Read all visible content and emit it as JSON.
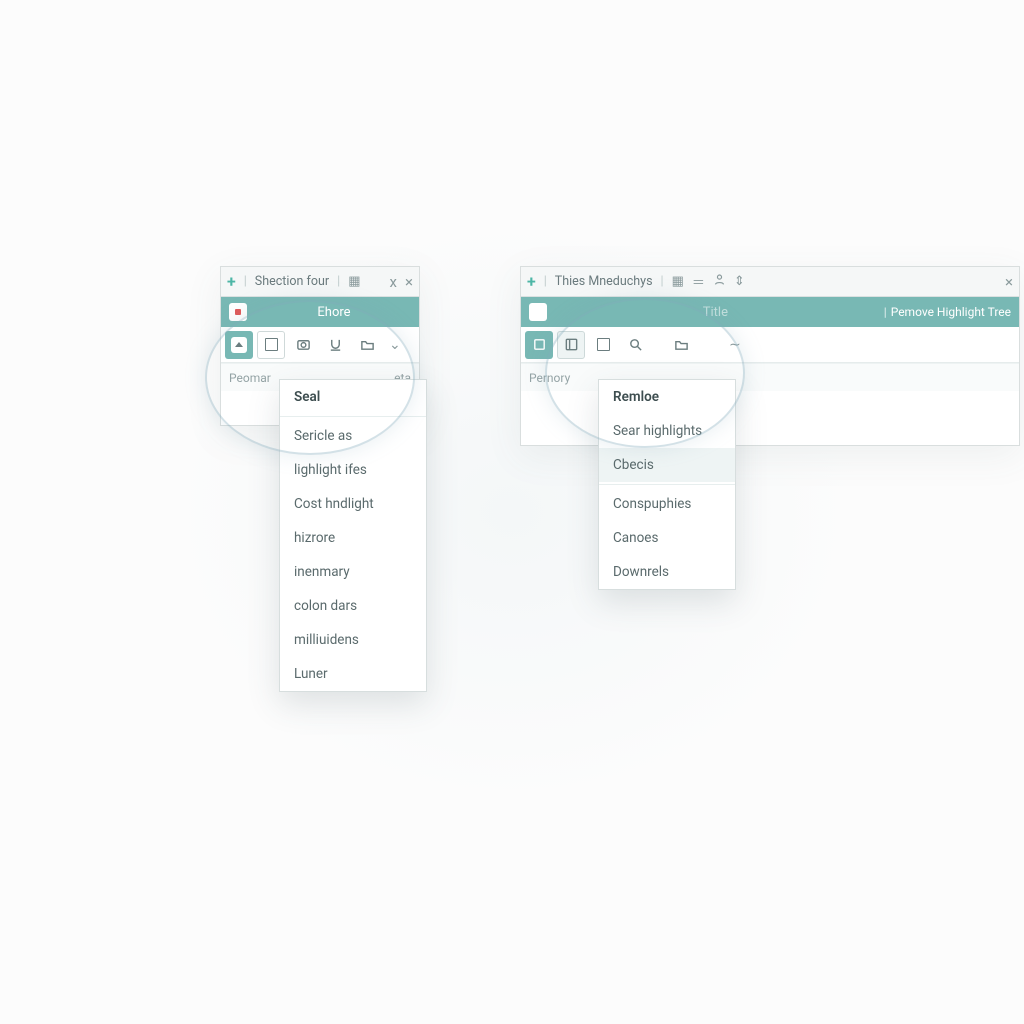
{
  "colors": {
    "accent": "#78b8b4",
    "text": "#556",
    "muted": "#94a3a5"
  },
  "left_panel": {
    "tabstrip": {
      "plus": "+",
      "title": "Shection four",
      "close_glyph": "×"
    },
    "header": {
      "title": "Ehore"
    },
    "toolbar_icons": [
      "caret-up",
      "box",
      "camera",
      "underline",
      "folder",
      "chevron-down"
    ],
    "rowbar_left": "Peomar",
    "rowbar_right": "eta",
    "dropdown": {
      "items": [
        {
          "label": "Seal",
          "strong": true
        },
        {
          "label": "—hr—"
        },
        {
          "label": "Sericle as"
        },
        {
          "label": "lighlight ifes"
        },
        {
          "label": "Cost hndlight"
        },
        {
          "label": "hizrore"
        },
        {
          "label": "inenmary"
        },
        {
          "label": "colon dars"
        },
        {
          "label": "milliuidens"
        },
        {
          "label": "Luner"
        }
      ]
    }
  },
  "right_panel": {
    "tabstrip": {
      "plus": "+",
      "title": "Thies Mneduchys",
      "icons": [
        "grid",
        "equal",
        "person",
        "pin"
      ],
      "close_glyph": "×"
    },
    "header": {
      "title": "Title",
      "right_label": "Pemove Highlight Tree"
    },
    "toolbar_icons": [
      "tile",
      "box",
      "outline-box",
      "search",
      "folder",
      "tilde"
    ],
    "rowbar_left": "Pernory",
    "dropdown": {
      "items": [
        {
          "label": "Remloe",
          "strong": true
        },
        {
          "label": "Sear highlights"
        },
        {
          "label": "Cbecis",
          "hover": true
        },
        {
          "label": "—hr—"
        },
        {
          "label": "Conspuphies"
        },
        {
          "label": "Canoes"
        },
        {
          "label": "Downrels"
        }
      ]
    }
  }
}
